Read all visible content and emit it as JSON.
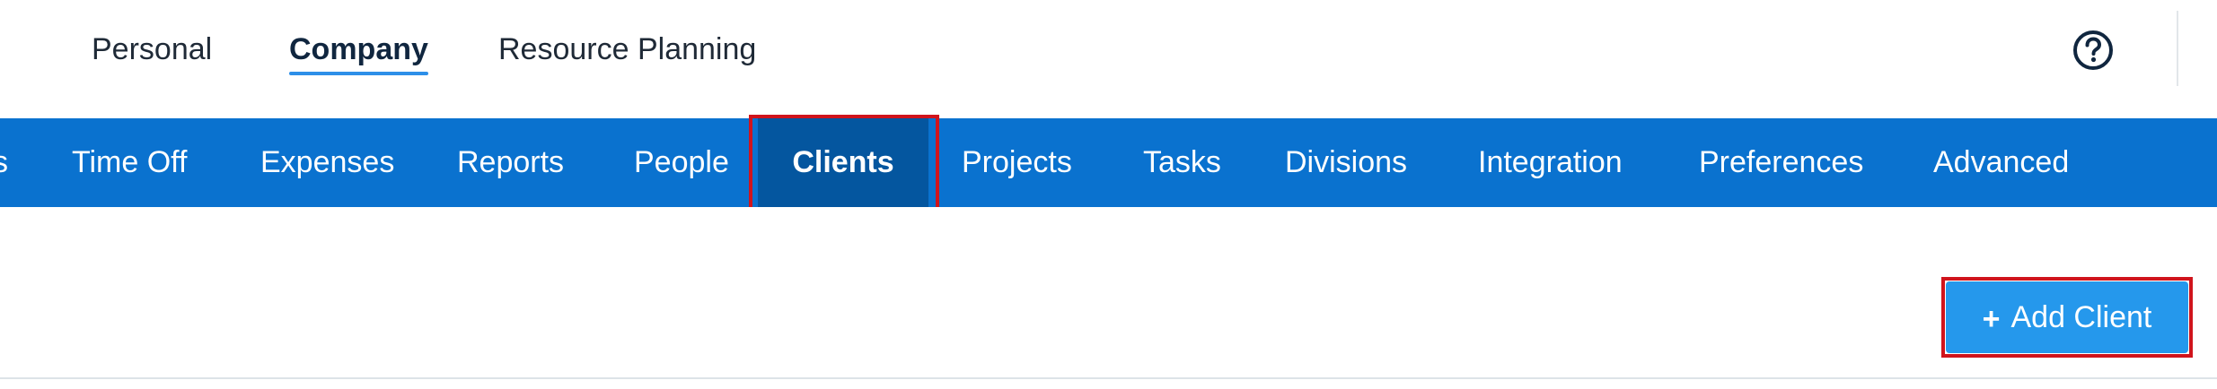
{
  "top_nav": {
    "tabs": [
      {
        "label": "Personal",
        "active": false
      },
      {
        "label": "Company",
        "active": true
      },
      {
        "label": "Resource Planning",
        "active": false
      }
    ],
    "help_icon": "question-circle-icon"
  },
  "main_nav": {
    "items": [
      {
        "label": "s",
        "active": false
      },
      {
        "label": "Time Off",
        "active": false
      },
      {
        "label": "Expenses",
        "active": false
      },
      {
        "label": "Reports",
        "active": false
      },
      {
        "label": "People",
        "active": false
      },
      {
        "label": "Clients",
        "active": true
      },
      {
        "label": "Projects",
        "active": false
      },
      {
        "label": "Tasks",
        "active": false
      },
      {
        "label": "Divisions",
        "active": false
      },
      {
        "label": "Integration",
        "active": false
      },
      {
        "label": "Preferences",
        "active": false
      },
      {
        "label": "Advanced",
        "active": false
      }
    ]
  },
  "actions": {
    "add_client_label": "Add Client",
    "add_client_icon": "plus-icon"
  },
  "colors": {
    "nav_background": "#0a72cf",
    "nav_active_background": "#04569f",
    "button_background": "#2598ec",
    "highlight_border": "#d0141c",
    "active_tab_underline": "#2d8fe8"
  }
}
